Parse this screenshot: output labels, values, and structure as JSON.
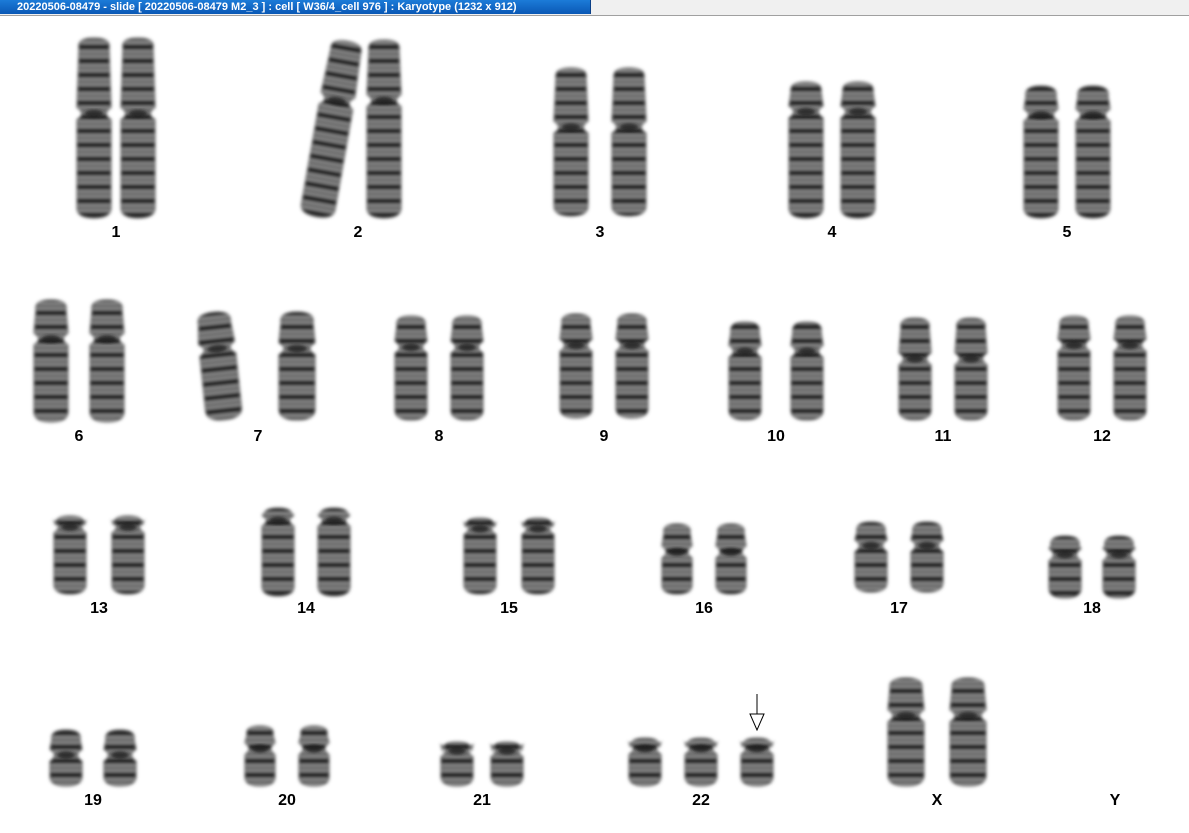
{
  "window": {
    "title": "20220506-08479 - slide [ 20220506-08479 M2_3 ] : cell [ W36/4_cell 976 ] : Karyotype  (1232 x 912)"
  },
  "karyotype": {
    "chromosomes": [
      {
        "id": "1",
        "label": "1",
        "count": 2
      },
      {
        "id": "2",
        "label": "2",
        "count": 2
      },
      {
        "id": "3",
        "label": "3",
        "count": 2
      },
      {
        "id": "4",
        "label": "4",
        "count": 2
      },
      {
        "id": "5",
        "label": "5",
        "count": 2
      },
      {
        "id": "6",
        "label": "6",
        "count": 2
      },
      {
        "id": "7",
        "label": "7",
        "count": 2
      },
      {
        "id": "8",
        "label": "8",
        "count": 2
      },
      {
        "id": "9",
        "label": "9",
        "count": 2
      },
      {
        "id": "10",
        "label": "10",
        "count": 2
      },
      {
        "id": "11",
        "label": "11",
        "count": 2
      },
      {
        "id": "12",
        "label": "12",
        "count": 2
      },
      {
        "id": "13",
        "label": "13",
        "count": 2
      },
      {
        "id": "14",
        "label": "14",
        "count": 2
      },
      {
        "id": "15",
        "label": "15",
        "count": 2
      },
      {
        "id": "16",
        "label": "16",
        "count": 2
      },
      {
        "id": "17",
        "label": "17",
        "count": 2
      },
      {
        "id": "18",
        "label": "18",
        "count": 2
      },
      {
        "id": "19",
        "label": "19",
        "count": 2
      },
      {
        "id": "20",
        "label": "20",
        "count": 2
      },
      {
        "id": "21",
        "label": "21",
        "count": 2
      },
      {
        "id": "22",
        "label": "22",
        "count": 3,
        "marked": true
      },
      {
        "id": "X",
        "label": "X",
        "count": 2
      },
      {
        "id": "Y",
        "label": "Y",
        "count": 0
      }
    ]
  },
  "colors": {
    "title_bar": "#0a58b5",
    "chromosome_dark": "#1e1e1e",
    "chromosome_light": "#8a8a8a"
  },
  "icons": {
    "abnormality_marker": "down-arrow-icon"
  }
}
